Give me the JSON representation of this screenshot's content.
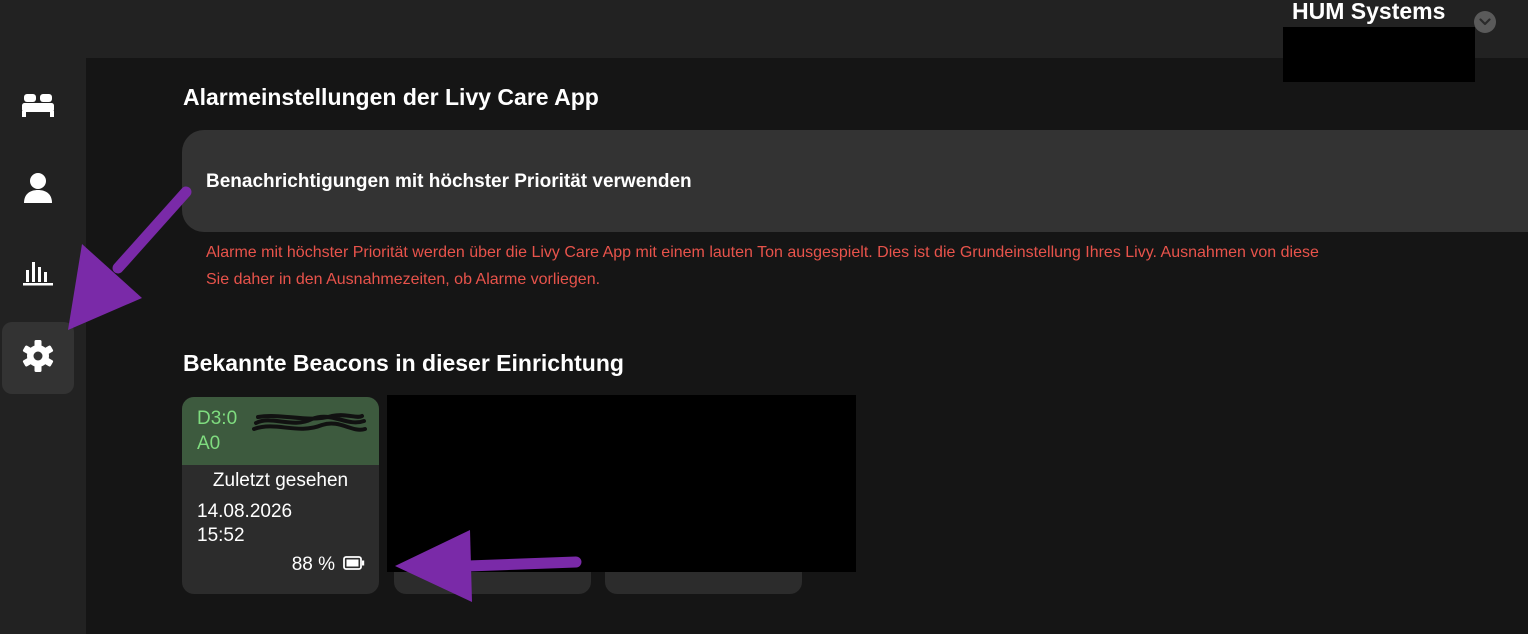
{
  "header": {
    "org_name": "HUM Systems"
  },
  "sidebar": {
    "items": [
      {
        "name": "beds",
        "icon": "bed-icon"
      },
      {
        "name": "residents",
        "icon": "person-icon"
      },
      {
        "name": "statistics",
        "icon": "bar-chart-icon"
      },
      {
        "name": "settings",
        "icon": "gear-icon",
        "active": true
      }
    ]
  },
  "alarm_settings": {
    "title": "Alarmeinstellungen der Livy Care App",
    "setting_label": "Benachrichtigungen mit höchster Priorität verwenden",
    "description_line1": "Alarme mit höchster Priorität werden über die Livy Care App mit einem lauten Ton ausgespielt. Dies ist die Grundeinstellung Ihres Livy. Ausnahmen von diese",
    "description_line2": "Sie daher in den Ausnahmezeiten, ob Alarme vorliegen.",
    "description_color": "#e8534b"
  },
  "beacons": {
    "title": "Bekannte Beacons in dieser Einrichtung",
    "items": [
      {
        "id_line1": "D3:0",
        "id_line2": "A0",
        "last_seen_label": "Zuletzt gesehen",
        "date": "14.08.2026",
        "time": "15:52",
        "battery": "88 %"
      }
    ]
  },
  "colors": {
    "background": "#151515",
    "panel": "#222222",
    "card": "#333333",
    "beacon_header": "#3d5a3e",
    "beacon_id": "#7fdc7f",
    "annotation_arrow": "#7a2aa8"
  }
}
